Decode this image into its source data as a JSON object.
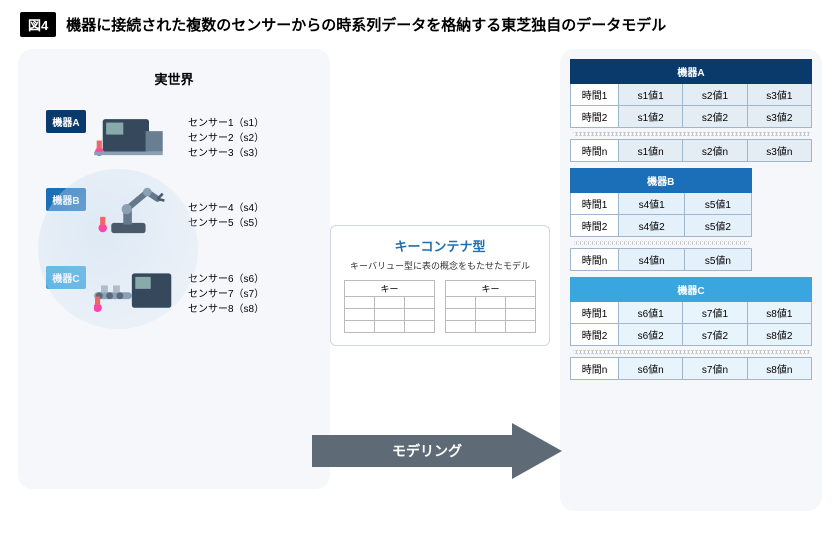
{
  "figure_label": "図4",
  "title": "機器に接続された複数のセンサーからの時系列データを格納する東芝独自のデータモデル",
  "left": {
    "heading": "実世界",
    "devices": [
      {
        "label": "機器A",
        "sensors": [
          "センサー1（s1）",
          "センサー2（s2）",
          "センサー3（s3）"
        ]
      },
      {
        "label": "機器B",
        "sensors": [
          "センサー4（s4）",
          "センサー5（s5）"
        ]
      },
      {
        "label": "機器C",
        "sensors": [
          "センサー6（s6）",
          "センサー7（s7）",
          "センサー8（s8）"
        ]
      }
    ]
  },
  "center": {
    "box_title": "キーコンテナ型",
    "box_subtitle": "キーバリュー型に表の概念をもたせたモデル",
    "key_label": "キー",
    "arrow_label": "モデリング"
  },
  "right": {
    "tables": [
      {
        "header": "機器A",
        "rows": [
          [
            "時間1",
            "s1値1",
            "s2値1",
            "s3値1"
          ],
          [
            "時間2",
            "s1値2",
            "s2値2",
            "s3値2"
          ],
          [
            "時間n",
            "s1値n",
            "s2値n",
            "s3値n"
          ]
        ]
      },
      {
        "header": "機器B",
        "rows": [
          [
            "時間1",
            "s4値1",
            "s5値1"
          ],
          [
            "時間2",
            "s4値2",
            "s5値2"
          ],
          [
            "時間n",
            "s4値n",
            "s5値n"
          ]
        ]
      },
      {
        "header": "機器C",
        "rows": [
          [
            "時間1",
            "s6値1",
            "s7値1",
            "s8値1"
          ],
          [
            "時間2",
            "s6値2",
            "s7値2",
            "s8値2"
          ],
          [
            "時間n",
            "s6値n",
            "s7値n",
            "s8値n"
          ]
        ]
      }
    ]
  }
}
